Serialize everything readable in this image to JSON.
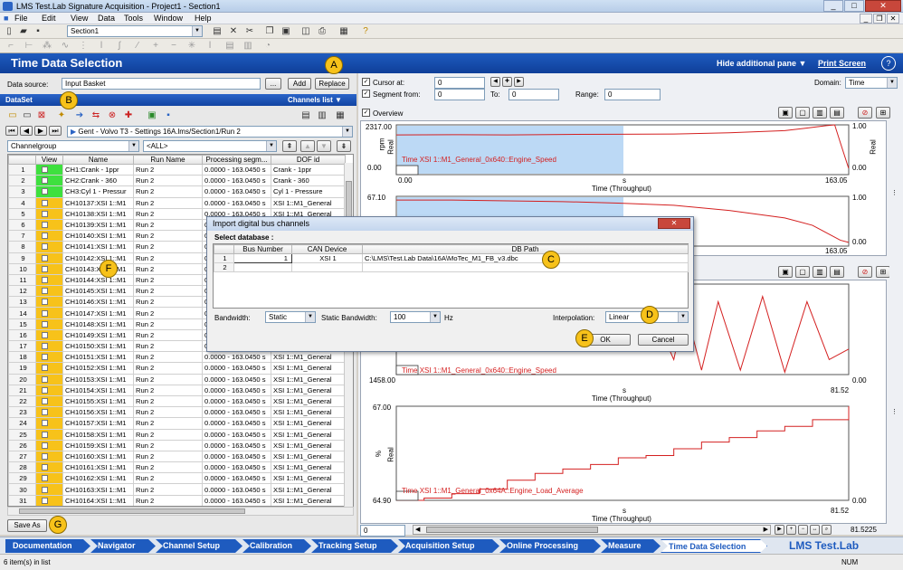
{
  "window": {
    "title": "LMS Test.Lab Signature Acquisition - Project1 - Section1",
    "min": "_",
    "max": "□",
    "close": "✕"
  },
  "menu": [
    "File",
    "Edit",
    "View",
    "Data",
    "Tools",
    "Window",
    "Help"
  ],
  "toolbar": {
    "section_value": "Section1"
  },
  "header": {
    "title": "Time Data Selection",
    "hide_pane": "Hide additional pane",
    "print_screen": "Print Screen",
    "help": "?"
  },
  "left": {
    "data_source_label": "Data source:",
    "data_source_value": "Input Basket",
    "ellipsis": "...",
    "add": "Add",
    "replace": "Replace",
    "dataset_label": "DataSet",
    "channels_list": "Channels list",
    "path": "Gent - Volvo T3 - Settings 16A.lms/Section1/Run 2",
    "channelgroup": "Channelgroup",
    "all": "<ALL>",
    "columns": [
      "",
      "View",
      "Name",
      "Run Name",
      "Processing segm...",
      "DOF id"
    ],
    "rows": [
      {
        "n": "1",
        "view": "green",
        "name": "CH1:Crank - 1ppr",
        "run": "Run 2",
        "seg": "0.0000 - 163.0450 s",
        "dof": "Crank - 1ppr"
      },
      {
        "n": "2",
        "view": "green",
        "name": "CH2:Crank - 360",
        "run": "Run 2",
        "seg": "0.0000 - 163.0450 s",
        "dof": "Crank - 360"
      },
      {
        "n": "3",
        "view": "green",
        "name": "CH3:Cyl 1 - Pressur",
        "run": "Run 2",
        "seg": "0.0000 - 163.0450 s",
        "dof": "Cyl 1 - Pressure"
      },
      {
        "n": "4",
        "view": "orange",
        "name": "CH10137:XSI 1::M1",
        "run": "Run 2",
        "seg": "0.0000 - 163.0450 s",
        "dof": "XSI 1::M1_General"
      },
      {
        "n": "5",
        "view": "orange",
        "name": "CH10138:XSI 1::M1",
        "run": "Run 2",
        "seg": "0.0000 - 163.0450 s",
        "dof": "XSI 1::M1_General"
      },
      {
        "n": "6",
        "view": "orange",
        "name": "CH10139:XSI 1::M1",
        "run": "Run 2",
        "seg": "0.0000 - 163.0450 s",
        "dof": "XSI 1::M1_General"
      },
      {
        "n": "7",
        "view": "orange",
        "name": "CH10140:XSI 1::M1",
        "run": "Run 2",
        "seg": "0.0000 - 163.0450 s",
        "dof": "XSI 1::M1_General"
      },
      {
        "n": "8",
        "view": "orange",
        "name": "CH10141:XSI 1::M1",
        "run": "Run 2",
        "seg": "0.0000 - 163.0450 s",
        "dof": "XSI 1::M1_General"
      },
      {
        "n": "9",
        "view": "orange",
        "name": "CH10142:XSI 1::M1",
        "run": "Run 2",
        "seg": "0.0000 - 163.0450 s",
        "dof": "XSI 1::M1_General"
      },
      {
        "n": "10",
        "view": "orange",
        "name": "CH10143:XSI 1::M1",
        "run": "Run 2",
        "seg": "0.0000 - 163.0450 s",
        "dof": "XSI 1::M1_General"
      },
      {
        "n": "11",
        "view": "orange",
        "name": "CH10144:XSI 1::M1",
        "run": "Run 2",
        "seg": "0.0000 - 163.0450 s",
        "dof": "XSI 1::M1_General"
      },
      {
        "n": "12",
        "view": "orange",
        "name": "CH10145:XSI 1::M1",
        "run": "Run 2",
        "seg": "0.0000 - 163.0450 s",
        "dof": "XSI 1::M1_General"
      },
      {
        "n": "13",
        "view": "orange",
        "name": "CH10146:XSI 1::M1",
        "run": "Run 2",
        "seg": "0.0000 - 163.0450 s",
        "dof": "XSI 1::M1_General"
      },
      {
        "n": "14",
        "view": "orange",
        "name": "CH10147:XSI 1::M1",
        "run": "Run 2",
        "seg": "0.0000 - 163.0450 s",
        "dof": "XSI 1::M1_General"
      },
      {
        "n": "15",
        "view": "orange",
        "name": "CH10148:XSI 1::M1",
        "run": "Run 2",
        "seg": "0.0000 - 163.0450 s",
        "dof": "XSI 1::M1_General"
      },
      {
        "n": "16",
        "view": "orange",
        "name": "CH10149:XSI 1::M1",
        "run": "Run 2",
        "seg": "0.0000 - 163.0450 s",
        "dof": "XSI 1::M1_General"
      },
      {
        "n": "17",
        "view": "orange",
        "name": "CH10150:XSI 1::M1",
        "run": "Run 2",
        "seg": "0.0000 - 163.0450 s",
        "dof": "XSI 1::M1_General"
      },
      {
        "n": "18",
        "view": "orange",
        "name": "CH10151:XSI 1::M1",
        "run": "Run 2",
        "seg": "0.0000 - 163.0450 s",
        "dof": "XSI 1::M1_General"
      },
      {
        "n": "19",
        "view": "orange",
        "name": "CH10152:XSI 1::M1",
        "run": "Run 2",
        "seg": "0.0000 - 163.0450 s",
        "dof": "XSI 1::M1_General"
      },
      {
        "n": "20",
        "view": "orange",
        "name": "CH10153:XSI 1::M1",
        "run": "Run 2",
        "seg": "0.0000 - 163.0450 s",
        "dof": "XSI 1::M1_General"
      },
      {
        "n": "21",
        "view": "orange",
        "name": "CH10154:XSI 1::M1",
        "run": "Run 2",
        "seg": "0.0000 - 163.0450 s",
        "dof": "XSI 1::M1_General"
      },
      {
        "n": "22",
        "view": "orange",
        "name": "CH10155:XSI 1::M1",
        "run": "Run 2",
        "seg": "0.0000 - 163.0450 s",
        "dof": "XSI 1::M1_General"
      },
      {
        "n": "23",
        "view": "orange",
        "name": "CH10156:XSI 1::M1",
        "run": "Run 2",
        "seg": "0.0000 - 163.0450 s",
        "dof": "XSI 1::M1_General"
      },
      {
        "n": "24",
        "view": "orange",
        "name": "CH10157:XSI 1::M1",
        "run": "Run 2",
        "seg": "0.0000 - 163.0450 s",
        "dof": "XSI 1::M1_General"
      },
      {
        "n": "25",
        "view": "orange",
        "name": "CH10158:XSI 1::M1",
        "run": "Run 2",
        "seg": "0.0000 - 163.0450 s",
        "dof": "XSI 1::M1_General"
      },
      {
        "n": "26",
        "view": "orange",
        "name": "CH10159:XSI 1::M1",
        "run": "Run 2",
        "seg": "0.0000 - 163.0450 s",
        "dof": "XSI 1::M1_General"
      },
      {
        "n": "27",
        "view": "orange",
        "name": "CH10160:XSI 1::M1",
        "run": "Run 2",
        "seg": "0.0000 - 163.0450 s",
        "dof": "XSI 1::M1_General"
      },
      {
        "n": "28",
        "view": "orange",
        "name": "CH10161:XSI 1::M1",
        "run": "Run 2",
        "seg": "0.0000 - 163.0450 s",
        "dof": "XSI 1::M1_General"
      },
      {
        "n": "29",
        "view": "orange",
        "name": "CH10162:XSI 1::M1",
        "run": "Run 2",
        "seg": "0.0000 - 163.0450 s",
        "dof": "XSI 1::M1_General"
      },
      {
        "n": "30",
        "view": "orange",
        "name": "CH10163:XSI 1::M1",
        "run": "Run 2",
        "seg": "0.0000 - 163.0450 s",
        "dof": "XSI 1::M1_General"
      },
      {
        "n": "31",
        "view": "orange",
        "name": "CH10164:XSI 1::M1",
        "run": "Run 2",
        "seg": "0.0000 - 163.0450 s",
        "dof": "XSI 1::M1_General"
      }
    ],
    "save_as": "Save As"
  },
  "right": {
    "cursor_label": "Cursor at:",
    "cursor_value": "0",
    "segment_label": "Segment from:",
    "segment_value": "0",
    "to_label": "To:",
    "to_value": "0",
    "range_label": "Range:",
    "range_value": "0",
    "domain_label": "Domain:",
    "domain_value": "Time",
    "overview_label": "Overview",
    "bottom_value": "0",
    "bottom_end": "81.5225"
  },
  "charts": {
    "c1": {
      "ymax": "2317.00",
      "ymin": "0.00",
      "ylab_left": "rpm",
      "ylab_real": "Real",
      "r_top": "1.00",
      "r_bot": "0.00",
      "x0": "0.00",
      "xunit": "s",
      "xend": "163.05",
      "xlabel": "Time (Throughput)",
      "legend": "Time XSI 1::M1_General_0x640::Engine_Speed"
    },
    "c2": {
      "ymax": "67.10",
      "r_top": "1.00",
      "r_bot": "0.00",
      "xend": "163.05"
    },
    "c3": {
      "ymin": "1458.00",
      "ymin2": "0.00",
      "xunit": "s",
      "xend": "81.52",
      "xlabel": "Time (Throughput)",
      "legend": "Time XSI 1::M1_General_0x640::Engine_Speed"
    },
    "c4": {
      "ymax": "67.00",
      "ymin": "64.90",
      "ymin2": "0.00",
      "ylab_left": "%",
      "ylab_real": "Real",
      "xunit": "s",
      "xend": "81.52",
      "xlabel": "Time (Throughput)",
      "legend": "Time XSI 1::M1_General_0x64A::Engine_Load_Average"
    }
  },
  "chart_data": [
    {
      "type": "line",
      "title": "",
      "xlabel": "Time (Throughput)",
      "ylabel": "Real",
      "ylim": [
        0,
        2317
      ],
      "xlim": [
        0,
        163.05
      ],
      "series": [
        {
          "name": "Time XSI 1::M1_General_0x640::Engine_Speed",
          "x": [
            0,
            20,
            40,
            60,
            80,
            100,
            120,
            140,
            150,
            155,
            158,
            160,
            163
          ],
          "y": [
            1850,
            1860,
            1850,
            1870,
            1880,
            1890,
            1950,
            2050,
            2200,
            2280,
            2317,
            1500,
            300
          ]
        }
      ]
    },
    {
      "type": "line",
      "title": "",
      "xlabel": "",
      "ylabel": "",
      "ylim": [
        0,
        67.1
      ],
      "xlim": [
        0,
        163.05
      ],
      "series": [
        {
          "x": [
            0,
            20,
            40,
            60,
            80,
            100,
            120,
            140,
            150,
            160,
            163
          ],
          "y": [
            62,
            62,
            61,
            60,
            58,
            55,
            48,
            38,
            28,
            8,
            5
          ]
        }
      ]
    },
    {
      "type": "line",
      "title": "",
      "xlabel": "Time (Throughput)",
      "ylabel": "",
      "ylim": [
        1458,
        2317
      ],
      "xlim": [
        0,
        81.52
      ],
      "series": [
        {
          "name": "Time XSI 1::M1_General_0x640::Engine_Speed",
          "x": [
            40,
            45,
            50,
            52,
            55,
            58,
            62,
            66,
            70,
            74,
            78,
            81.52
          ],
          "y": [
            1900,
            2200,
            1600,
            2100,
            1500,
            2150,
            1500,
            2200,
            1480,
            2150,
            1600,
            1700
          ]
        }
      ]
    },
    {
      "type": "line",
      "title": "",
      "xlabel": "Time (Throughput)",
      "ylabel": "Real",
      "ylim": [
        64.9,
        67
      ],
      "xlim": [
        0,
        81.52
      ],
      "series": [
        {
          "name": "Time XSI 1::M1_General_0x64A::Engine_Load_Average",
          "x": [
            0,
            5,
            10,
            15,
            20,
            25,
            30,
            35,
            40,
            45,
            50,
            55,
            60,
            65,
            70,
            75,
            81.52
          ],
          "y": [
            64.9,
            64.95,
            65.05,
            65.15,
            65.35,
            65.5,
            65.6,
            65.7,
            65.85,
            65.9,
            66.05,
            66.2,
            66.3,
            66.45,
            66.55,
            66.7,
            67.0
          ]
        }
      ]
    }
  ],
  "dialog": {
    "title": "Import digital bus channels",
    "close": "✕",
    "select_db": "Select database :",
    "columns": [
      "",
      "Bus Number",
      "CAN Device",
      "DB Path"
    ],
    "rows": [
      {
        "n": "1",
        "bus": "1",
        "device": "XSI 1",
        "path": "C:\\LMS\\Test.Lab Data\\16A\\MoTec_M1_FB_v3.dbc"
      },
      {
        "n": "2",
        "bus": "",
        "device": "",
        "path": ""
      }
    ],
    "bandwidth_label": "Bandwidth:",
    "bandwidth_value": "Static",
    "static_bw_label": "Static Bandwidth:",
    "static_bw_value": "100",
    "hz": "Hz",
    "interp_label": "Interpolation:",
    "interp_value": "Linear",
    "ok": "OK",
    "cancel": "Cancel"
  },
  "markers": {
    "A": "A",
    "B": "B",
    "C": "C",
    "D": "D",
    "E": "E",
    "F": "F",
    "G": "G"
  },
  "workflow": [
    "Documentation",
    "Navigator",
    "Channel Setup",
    "Calibration",
    "Tracking Setup",
    "Acquisition Setup",
    "Online Processing",
    "Measure",
    "Time Data Selection"
  ],
  "brand": "LMS Test.Lab",
  "status": {
    "left": "6 item(s) in list",
    "right": "NUM"
  },
  "colors": {
    "header": "#1e5bbf",
    "trace": "#d42020",
    "selection": "#bcd9f5",
    "marker": "#f7c21a"
  }
}
